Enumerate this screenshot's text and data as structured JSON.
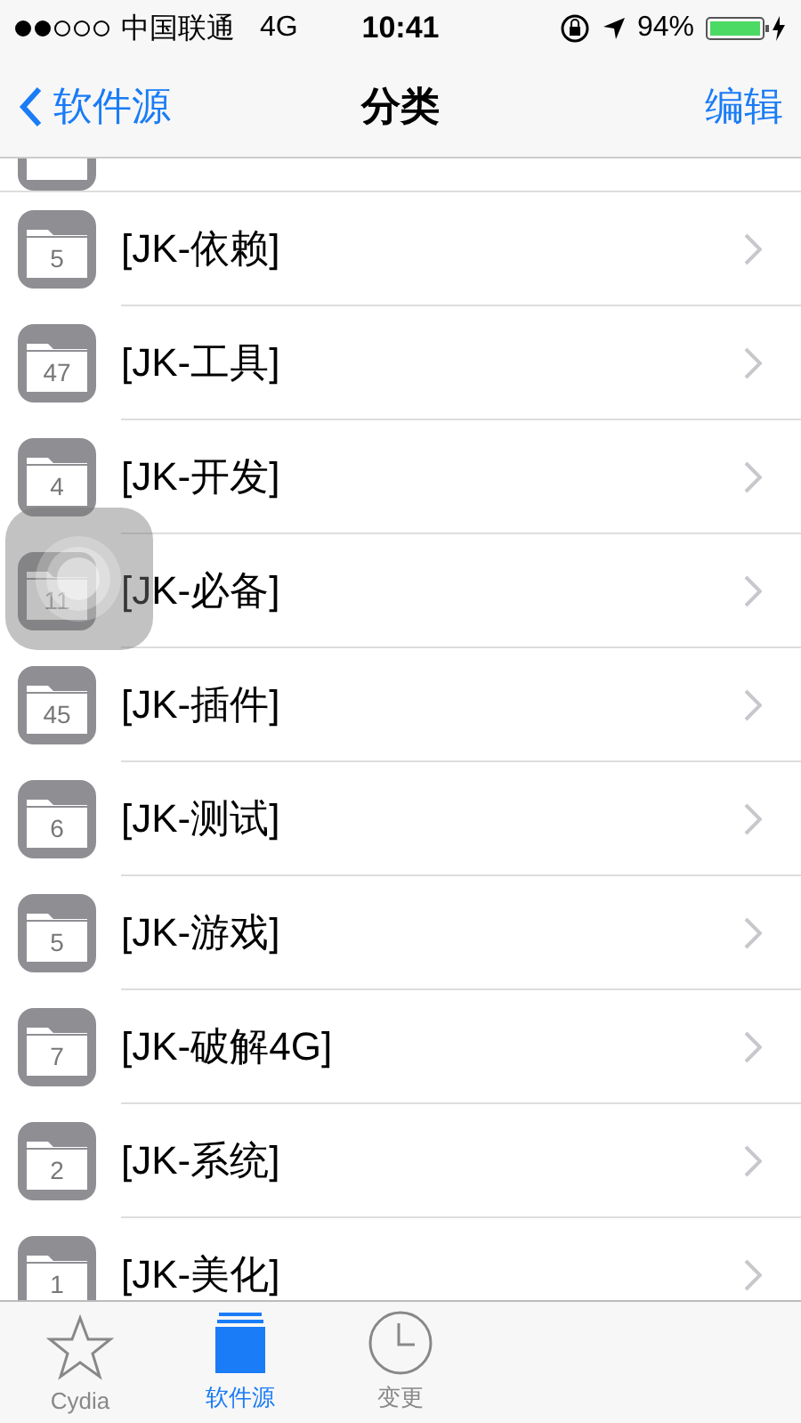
{
  "status_bar": {
    "carrier": "中国联通",
    "network": "4G",
    "time": "10:41",
    "battery": "94%"
  },
  "nav": {
    "back": "软件源",
    "title": "分类",
    "action": "编辑"
  },
  "categories": [
    {
      "count": "5",
      "name": "[JK-依赖]"
    },
    {
      "count": "47",
      "name": "[JK-工具]"
    },
    {
      "count": "4",
      "name": "[JK-开发]"
    },
    {
      "count": "11",
      "name": "[JK-必备]"
    },
    {
      "count": "45",
      "name": "[JK-插件]"
    },
    {
      "count": "6",
      "name": "[JK-测试]"
    },
    {
      "count": "5",
      "name": "[JK-游戏]"
    },
    {
      "count": "7",
      "name": "[JK-破解4G]"
    },
    {
      "count": "2",
      "name": "[JK-系统]"
    },
    {
      "count": "1",
      "name": "[JK-美化]"
    }
  ],
  "tabs": [
    {
      "kind": "star",
      "label": "Cydia",
      "selected": false
    },
    {
      "kind": "sources",
      "label": "软件源",
      "selected": true
    },
    {
      "kind": "clock",
      "label": "变更",
      "selected": false
    }
  ]
}
